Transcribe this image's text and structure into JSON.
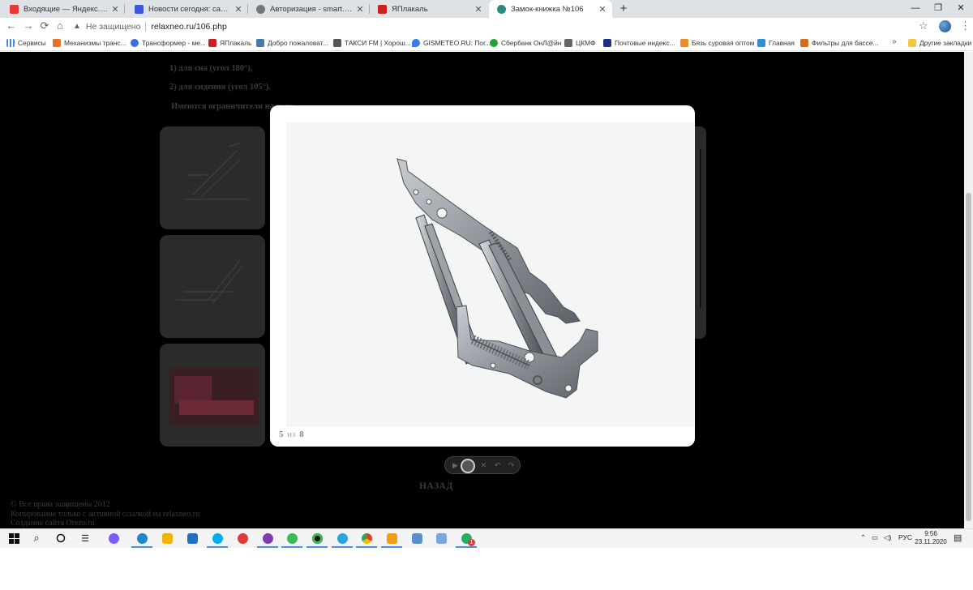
{
  "browser": {
    "tabs": [
      {
        "title": "Входящие — Яндекс.Почта",
        "color": "#e53935",
        "active": false
      },
      {
        "title": "Новости сегодня: самые свежие",
        "color": "#3a5ad9",
        "active": false
      },
      {
        "title": "Авторизация - smart.ckmf.ru - M",
        "color": "#777777",
        "active": false
      },
      {
        "title": "ЯПлакаль",
        "color": "#cf2020",
        "active": false
      },
      {
        "title": "Замок-книжка №106",
        "color": "#2b8a7e",
        "active": true
      }
    ],
    "new_tab": "+",
    "window": {
      "minimize": "—",
      "restore": "❐",
      "close": "✕"
    },
    "nav": {
      "back": "←",
      "forward": "→",
      "reload": "⟳",
      "home": "⌂"
    },
    "address": {
      "security_label": "Не защищено",
      "url": "relaxneo.ru/106.php"
    },
    "bookmarks": [
      {
        "label": "Сервисы",
        "color": "#4285f4"
      },
      {
        "label": "Механизмы транс...",
        "color": "#e8712a"
      },
      {
        "label": "Трансформер - ме...",
        "color": "#3b6fd4"
      },
      {
        "label": "ЯПлакаль",
        "color": "#cf2020"
      },
      {
        "label": "Добро пожаловат...",
        "color": "#4a76a8"
      },
      {
        "label": "ТАКСИ FM | Хорош...",
        "color": "#555555"
      },
      {
        "label": "GISMETEO.RU: Пог...",
        "color": "#2f80ed"
      },
      {
        "label": "Сбербанк ОнЛ@йн",
        "color": "#21a038"
      },
      {
        "label": "ЦКМФ",
        "color": "#666666"
      },
      {
        "label": "Почтовые индекс...",
        "color": "#1d2f8c"
      },
      {
        "label": "Бязь суровая оптом",
        "color": "#f08a24"
      },
      {
        "label": "Главная",
        "color": "#2d8fd5"
      },
      {
        "label": "Фильтры для бассе...",
        "color": "#d86a1a"
      },
      {
        "label": "Другие закладки",
        "color": "#f4c542"
      }
    ],
    "bookmarks_more": "»"
  },
  "page": {
    "list_item_1": "1)      для сна (угол 180°),",
    "list_item_2": "2)      для сидения (угол 105°).",
    "limiters_text": "Имеются ограничители на ходу",
    "back_link": "НАЗАД",
    "footer": {
      "copyright": "© Все права защищены 2012",
      "copy_note": "Копирование только с активной ссылкой на relaxneo.ru",
      "made_by": "Создание сайта Orezo.ru"
    }
  },
  "lightbox": {
    "counter_current": "5",
    "counter_sep": "из",
    "counter_total": "8",
    "image_icon": "sofa-lift-mechanism",
    "controls": {
      "play": "▶",
      "close": "✕",
      "prev": "↶",
      "next": "↷"
    }
  },
  "taskbar": {
    "language": "РУС",
    "time": "9:56",
    "date": "23.11.2020",
    "notifications": "1",
    "apps": [
      {
        "name": "alice",
        "color": "#7b5cff"
      },
      {
        "name": "edge",
        "color": "#1e88c9"
      },
      {
        "name": "explorer",
        "color": "#f2b400"
      },
      {
        "name": "mail",
        "color": "#1f6fc5"
      },
      {
        "name": "skype",
        "color": "#00aff0"
      },
      {
        "name": "yandex",
        "color": "#e53935"
      },
      {
        "name": "viber",
        "color": "#7d3daf"
      },
      {
        "name": "icq",
        "color": "#3cba54"
      },
      {
        "name": "antivirus",
        "color": "#111111"
      },
      {
        "name": "telegram",
        "color": "#2aa3df"
      },
      {
        "name": "chrome",
        "color": "#e33b2e"
      },
      {
        "name": "app-orange",
        "color": "#f39c12"
      },
      {
        "name": "app-network",
        "color": "#5d8fc7"
      },
      {
        "name": "app-wizard",
        "color": "#7aa7d8"
      },
      {
        "name": "app-green",
        "color": "#27ae60"
      }
    ]
  }
}
